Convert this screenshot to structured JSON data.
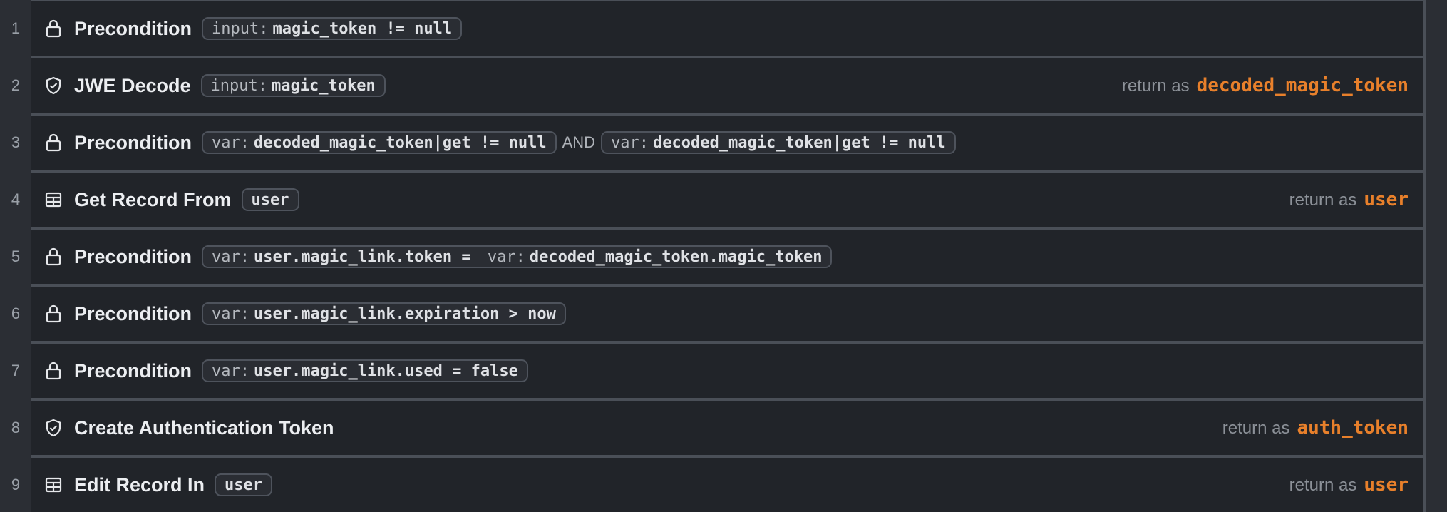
{
  "accent_color": "#e8802b",
  "return_label": "return as",
  "steps": [
    {
      "num": "1",
      "icon": "lock-icon",
      "title": "Precondition",
      "parts": [
        {
          "k": "input:",
          "v": "magic_token != null"
        }
      ]
    },
    {
      "num": "2",
      "icon": "shield-check-icon",
      "title": "JWE Decode",
      "parts": [
        {
          "k": "input:",
          "v": "magic_token"
        }
      ],
      "ret": "decoded_magic_token"
    },
    {
      "num": "3",
      "icon": "lock-icon",
      "title": "Precondition",
      "parts": [
        {
          "k": "var:",
          "v": "decoded_magic_token|get != null"
        },
        {
          "and": "AND"
        },
        {
          "k": "var:",
          "v": "decoded_magic_token|get != null"
        }
      ]
    },
    {
      "num": "4",
      "icon": "table-icon",
      "title": "Get Record From",
      "parts": [
        {
          "v": "user"
        }
      ],
      "ret": "user"
    },
    {
      "num": "5",
      "icon": "lock-icon",
      "title": "Precondition",
      "parts": [
        {
          "k": "var:",
          "v": "user.magic_link.token = ",
          "k2": "var:",
          "v2": "decoded_magic_token.magic_token"
        }
      ]
    },
    {
      "num": "6",
      "icon": "lock-icon",
      "title": "Precondition",
      "parts": [
        {
          "k": "var:",
          "v": "user.magic_link.expiration > now"
        }
      ]
    },
    {
      "num": "7",
      "icon": "lock-icon",
      "title": "Precondition",
      "parts": [
        {
          "k": "var:",
          "v": "user.magic_link.used = false"
        }
      ]
    },
    {
      "num": "8",
      "icon": "shield-check-icon",
      "title": "Create Authentication Token",
      "parts": [],
      "ret": "auth_token"
    },
    {
      "num": "9",
      "icon": "table-icon",
      "title": "Edit Record In",
      "parts": [
        {
          "v": "user"
        }
      ],
      "ret": "user"
    }
  ]
}
